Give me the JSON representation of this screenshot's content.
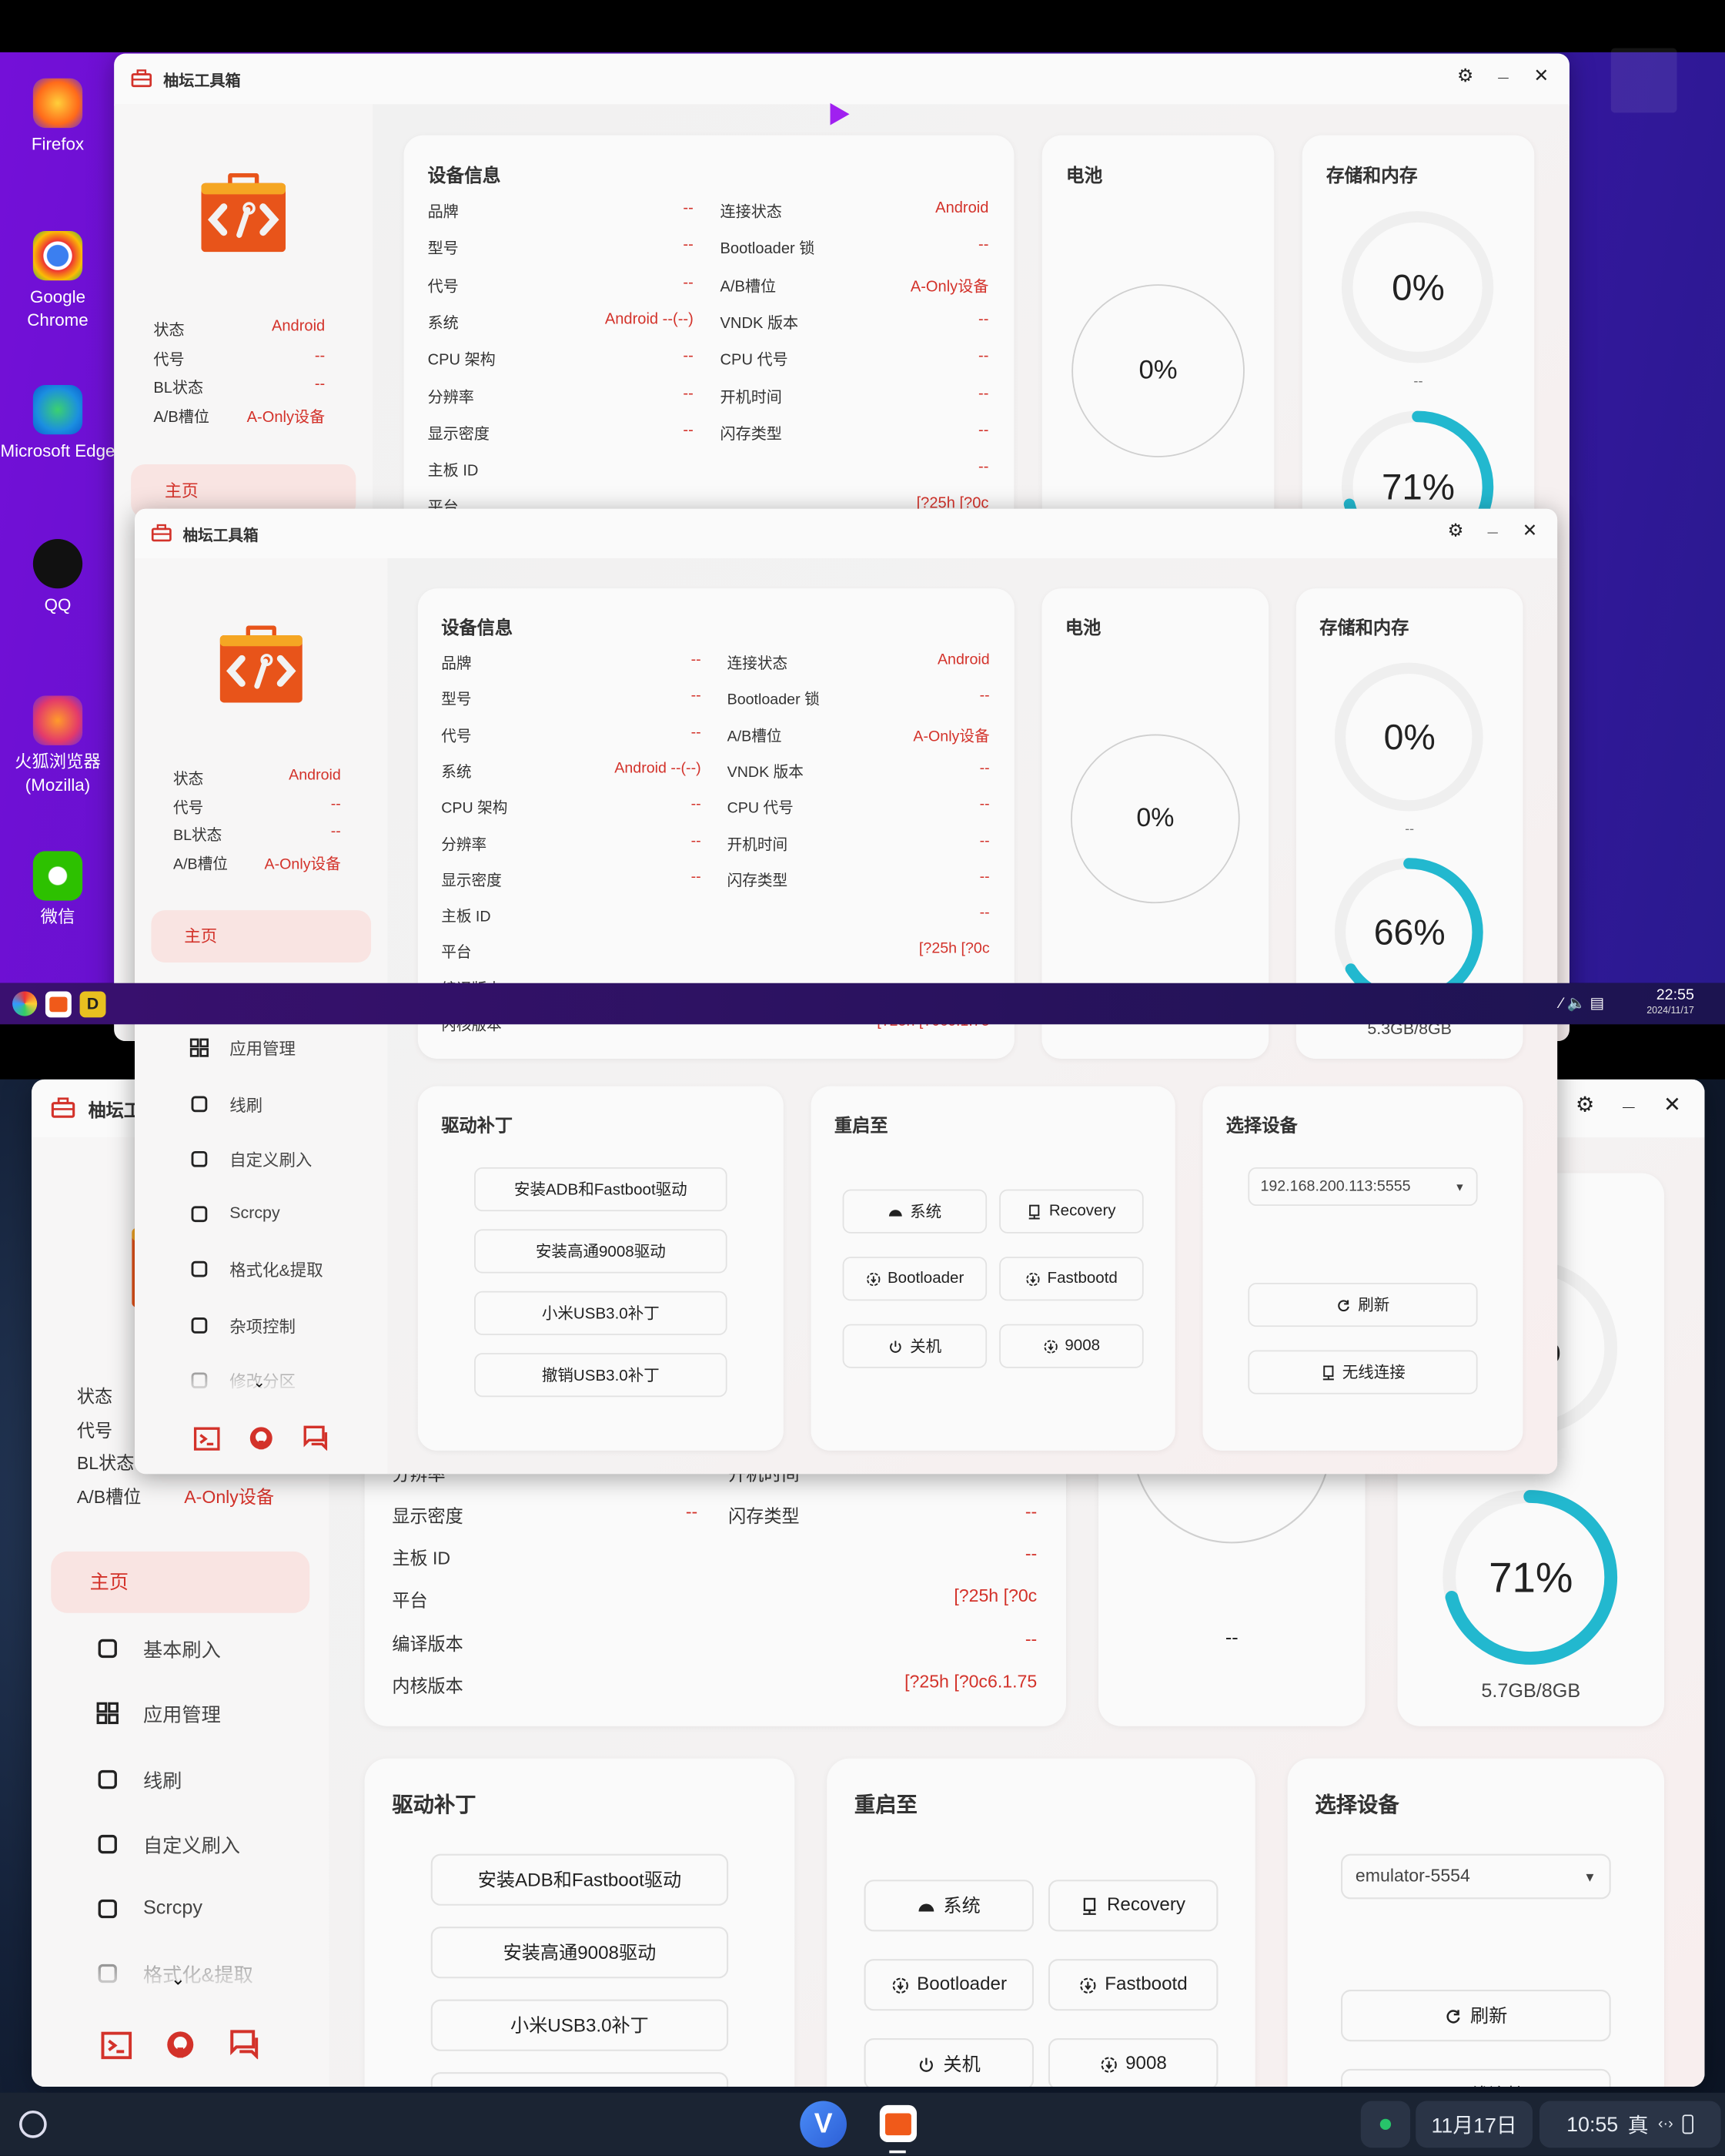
{
  "accent_color": "#d3322a",
  "ring_color": "#22b8cf",
  "remote_desktop": {
    "icons": [
      {
        "label": "Firefox",
        "icon": "firefox-icon"
      },
      {
        "label": "Google Chrome",
        "icon": "chrome-icon"
      },
      {
        "label": "Microsoft Edge",
        "icon": "edge-icon"
      },
      {
        "label": "QQ",
        "icon": "qq-icon"
      },
      {
        "label": "火狐浏览器 (Mozilla)",
        "icon": "firefox-china-icon"
      },
      {
        "label": "微信",
        "icon": "wechat-icon"
      }
    ],
    "taskbar": {
      "time": "22:55",
      "date": "2024/11/17"
    }
  },
  "taskbar": {
    "date": "11月17日",
    "time": "10:55",
    "ime": "真"
  },
  "app": {
    "title": "柚坛工具箱",
    "sidebar_status": [
      {
        "label": "状态",
        "value": "Android"
      },
      {
        "label": "代号",
        "value": "--"
      },
      {
        "label": "BL状态",
        "value": "--"
      },
      {
        "label": "A/B槽位",
        "value": "A-Only设备"
      }
    ],
    "home": "主页",
    "nav": [
      {
        "label": "基本刷入",
        "icon": "flash-icon"
      },
      {
        "label": "应用管理",
        "icon": "apps-icon"
      },
      {
        "label": "线刷",
        "icon": "usb-icon"
      },
      {
        "label": "自定义刷入",
        "icon": "magic-wand-icon"
      },
      {
        "label": "Scrcpy",
        "icon": "devices-icon"
      },
      {
        "label": "格式化&提取",
        "icon": "worker-icon"
      },
      {
        "label": "杂项控制",
        "icon": "wrench-gear-icon"
      },
      {
        "label": "修改分区",
        "icon": "partition-icon"
      }
    ],
    "device_info": {
      "title": "设备信息",
      "rows": [
        {
          "l": "品牌",
          "lv": "--",
          "r": "连接状态",
          "rv": "Android"
        },
        {
          "l": "型号",
          "lv": "--",
          "r": "Bootloader 锁",
          "rv": "--"
        },
        {
          "l": "代号",
          "lv": "--",
          "r": "A/B槽位",
          "rv": "A-Only设备"
        },
        {
          "l": "系统",
          "lv": "Android --(--)",
          "r": "VNDK 版本",
          "rv": "--"
        },
        {
          "l": "CPU 架构",
          "lv": "--",
          "r": "CPU 代号",
          "rv": "--"
        },
        {
          "l": "分辨率",
          "lv": "--",
          "r": "开机时间",
          "rv": "--"
        },
        {
          "l": "显示密度",
          "lv": "--",
          "r": "闪存类型",
          "rv": "--"
        },
        {
          "l": "主板 ID",
          "lv": "",
          "r": "",
          "rv": "--"
        },
        {
          "l": "平台",
          "lv": "",
          "r": "",
          "rv": "[?25h  [?0c"
        },
        {
          "l": "编译版本",
          "lv": "",
          "r": "",
          "rv": "--"
        },
        {
          "l": "内核版本",
          "lv": "",
          "r": "",
          "rv": "[?25h  [?0c6.1.75"
        }
      ]
    },
    "battery": {
      "title": "电池",
      "percent": "0%",
      "extra": "--"
    },
    "storage": {
      "title": "存储和内存",
      "storage_percent": "0%",
      "storage_text": "--"
    },
    "drivers": {
      "title": "驱动补丁",
      "buttons": [
        "安装ADB和Fastboot驱动",
        "安装高通9008驱动",
        "小米USB3.0补丁",
        "撤销USB3.0补丁"
      ]
    },
    "reboot": {
      "title": "重启至",
      "buttons": [
        {
          "label": "系统",
          "icon": "android-icon"
        },
        {
          "label": "Recovery",
          "icon": "recovery-icon"
        },
        {
          "label": "Bootloader",
          "icon": "download-circle-icon"
        },
        {
          "label": "Fastbootd",
          "icon": "download-circle-icon"
        },
        {
          "label": "关机",
          "icon": "power-icon"
        },
        {
          "label": "9008",
          "icon": "download-circle-icon"
        }
      ]
    },
    "device_select": {
      "title": "选择设备",
      "refresh": "刷新",
      "wireless": "无线连接"
    }
  },
  "windows": [
    {
      "memory_percent": "71%",
      "memory_value": 71
    },
    {
      "memory_percent": "66%",
      "memory_value": 66,
      "memory_text": "5.3GB/8GB",
      "selected_device": "192.168.200.113:5555"
    },
    {
      "memory_percent": "71%",
      "memory_value": 71,
      "memory_text": "5.7GB/8GB",
      "selected_device": "emulator-5554"
    }
  ]
}
